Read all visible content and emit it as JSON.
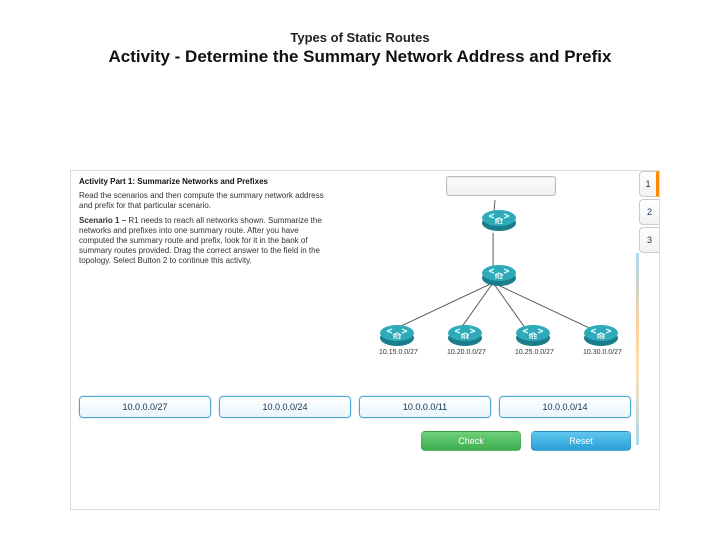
{
  "header": {
    "small": "Types of Static Routes",
    "big": "Activity - Determine the Summary Network Address and Prefix"
  },
  "instructions": {
    "part_title": "Activity Part 1: Summarize Networks and Prefixes",
    "intro": "Read the scenarios and then compute the summary network address and prefix for that particular scenario.",
    "scenario_label": "Scenario 1 –",
    "scenario_text": "R1 needs to reach all networks shown. Summarize the networks and prefixes into one summary route. After you have computed the summary route and prefix, look for it in the bank of summary routes provided. Drag the correct answer to the field in the topology. Select Button 2 to continue this activity."
  },
  "routers": {
    "r1": {
      "name": "R1",
      "ip": ""
    },
    "r2": {
      "name": "R2",
      "ip": ""
    },
    "r3": {
      "name": "R3",
      "ip": "10.15.0.0/27"
    },
    "r4": {
      "name": "R4",
      "ip": "10.20.0.0/27"
    },
    "r5": {
      "name": "R5",
      "ip": "10.25.0.0/27"
    },
    "r6": {
      "name": "R6",
      "ip": "10.30.0.0/27"
    }
  },
  "steps": [
    "1",
    "2",
    "3"
  ],
  "answers": [
    "10.0.0.0/27",
    "10.0.0.0/24",
    "10.0.0.0/11",
    "10.0.0.0/14"
  ],
  "buttons": {
    "check": "Check",
    "reset": "Reset"
  }
}
